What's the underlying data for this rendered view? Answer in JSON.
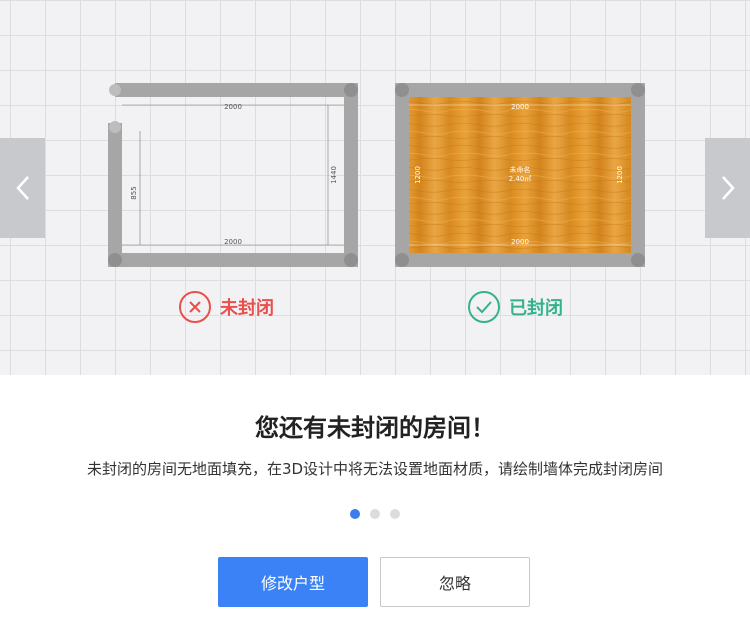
{
  "illustration": {
    "open_room": {
      "status_label": "未封闭",
      "top_dim": "2000",
      "bottom_dim": "2000",
      "left_dim": "855",
      "right_dim": "1440"
    },
    "closed_room": {
      "status_label": "已封闭",
      "top_dim": "2000",
      "bottom_dim": "2000",
      "left_dim": "1200",
      "right_dim": "1200",
      "center_name": "未命名",
      "center_area": "2.40㎡"
    }
  },
  "dialog": {
    "title": "您还有未封闭的房间！",
    "description": "未封闭的房间无地面填充，在3D设计中将无法设置地面材质，请绘制墙体完成封闭房间"
  },
  "pagination": {
    "total": 3,
    "active": 0
  },
  "buttons": {
    "primary_label": "修改户型",
    "secondary_label": "忽略"
  },
  "colors": {
    "primary": "#3b82f6",
    "open_status": "#e8504d",
    "closed_status": "#34b28c"
  }
}
